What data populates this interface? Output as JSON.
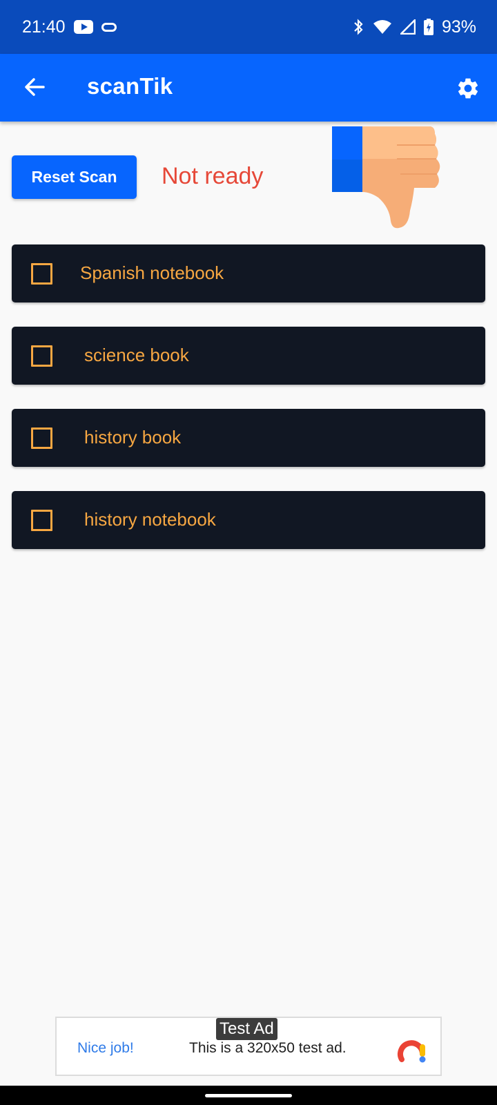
{
  "status_bar": {
    "time": "21:40",
    "battery": "93%"
  },
  "app_bar": {
    "title": "scanTik",
    "back_icon": "arrow-back-icon",
    "settings_icon": "gear-icon"
  },
  "controls": {
    "reset_label": "Reset Scan",
    "status_text": "Not ready",
    "status_color": "#e64838",
    "status_icon": "thumbs-down-icon"
  },
  "items": [
    {
      "label": "Spanish notebook",
      "checked": false
    },
    {
      "label": "science book",
      "checked": false
    },
    {
      "label": "history book",
      "checked": false
    },
    {
      "label": "history notebook",
      "checked": false
    }
  ],
  "ad": {
    "badge": "Test Ad",
    "headline": "Nice job!",
    "text": "This is a 320x50 test ad."
  },
  "colors": {
    "status_bar": "#0a4bbb",
    "app_bar": "#0765fe",
    "item_bg": "#111723",
    "item_text": "#f7a742"
  }
}
